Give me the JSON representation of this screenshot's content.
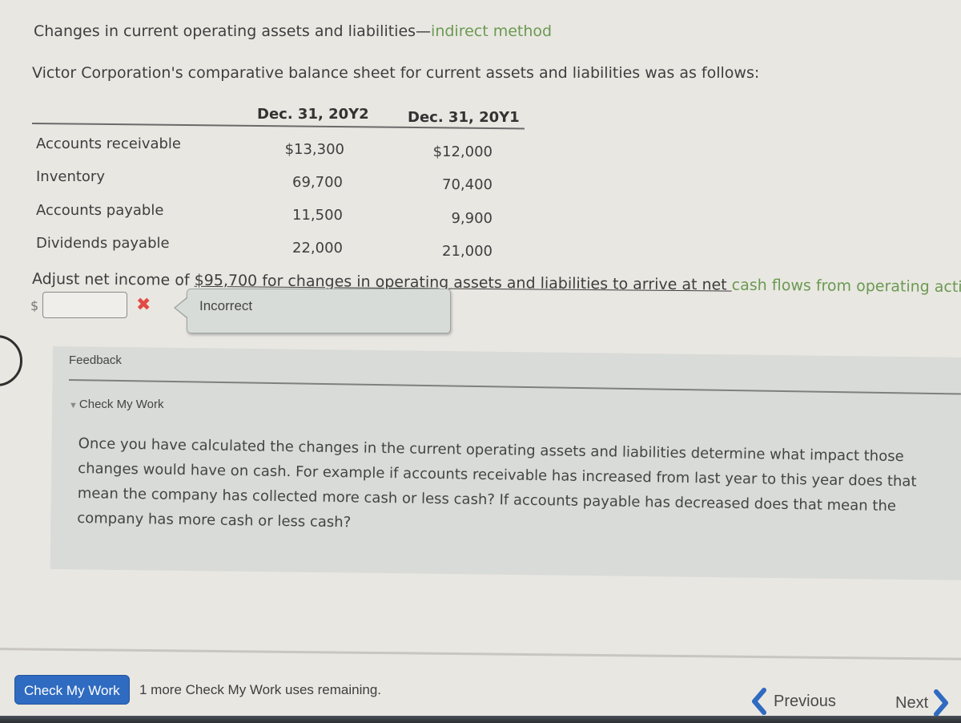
{
  "title": {
    "main": "Changes in current operating assets and liabilities—",
    "link": "indirect method"
  },
  "intro": "Victor Corporation's comparative balance sheet for current assets and liabilities was as follows:",
  "table": {
    "columns": [
      "Dec. 31, 20Y2",
      "Dec. 31, 20Y1"
    ],
    "rows": [
      {
        "label": "Accounts receivable",
        "values": [
          "$13,300",
          "$12,000"
        ]
      },
      {
        "label": "Inventory",
        "values": [
          "69,700",
          "70,400"
        ]
      },
      {
        "label": "Accounts payable",
        "values": [
          "11,500",
          "9,900"
        ]
      },
      {
        "label": "Dividends payable",
        "values": [
          "22,000",
          "21,000"
        ]
      }
    ]
  },
  "question": {
    "prefix": "Adjust net income of ",
    "amount": "$95,700",
    "middle": " for changes in operating assets and liabilities to arrive at net ",
    "link": "cash flows from operating activities",
    "suffix": "."
  },
  "answer": {
    "currency": "$",
    "value": "",
    "status_icon": "x-mark-icon",
    "tooltip": "Incorrect"
  },
  "feedback": {
    "label": "Feedback",
    "section_label": "Check My Work",
    "hint": "Once you have calculated the changes in the current operating assets and liabilities determine what impact those changes would have on cash. For example if accounts receivable has increased from last year to this year does that mean the company has collected more cash or less cash? If accounts payable has decreased does that mean the company has more cash or less cash?"
  },
  "footer": {
    "check_button": "Check My Work",
    "remaining": "1 more Check My Work uses remaining.",
    "previous": "Previous",
    "next": "Next"
  },
  "colors": {
    "link_green": "#6b9a52",
    "button_blue": "#2f6bc1",
    "error_red": "#e24a43",
    "nav_blue": "#2f6bc1"
  }
}
